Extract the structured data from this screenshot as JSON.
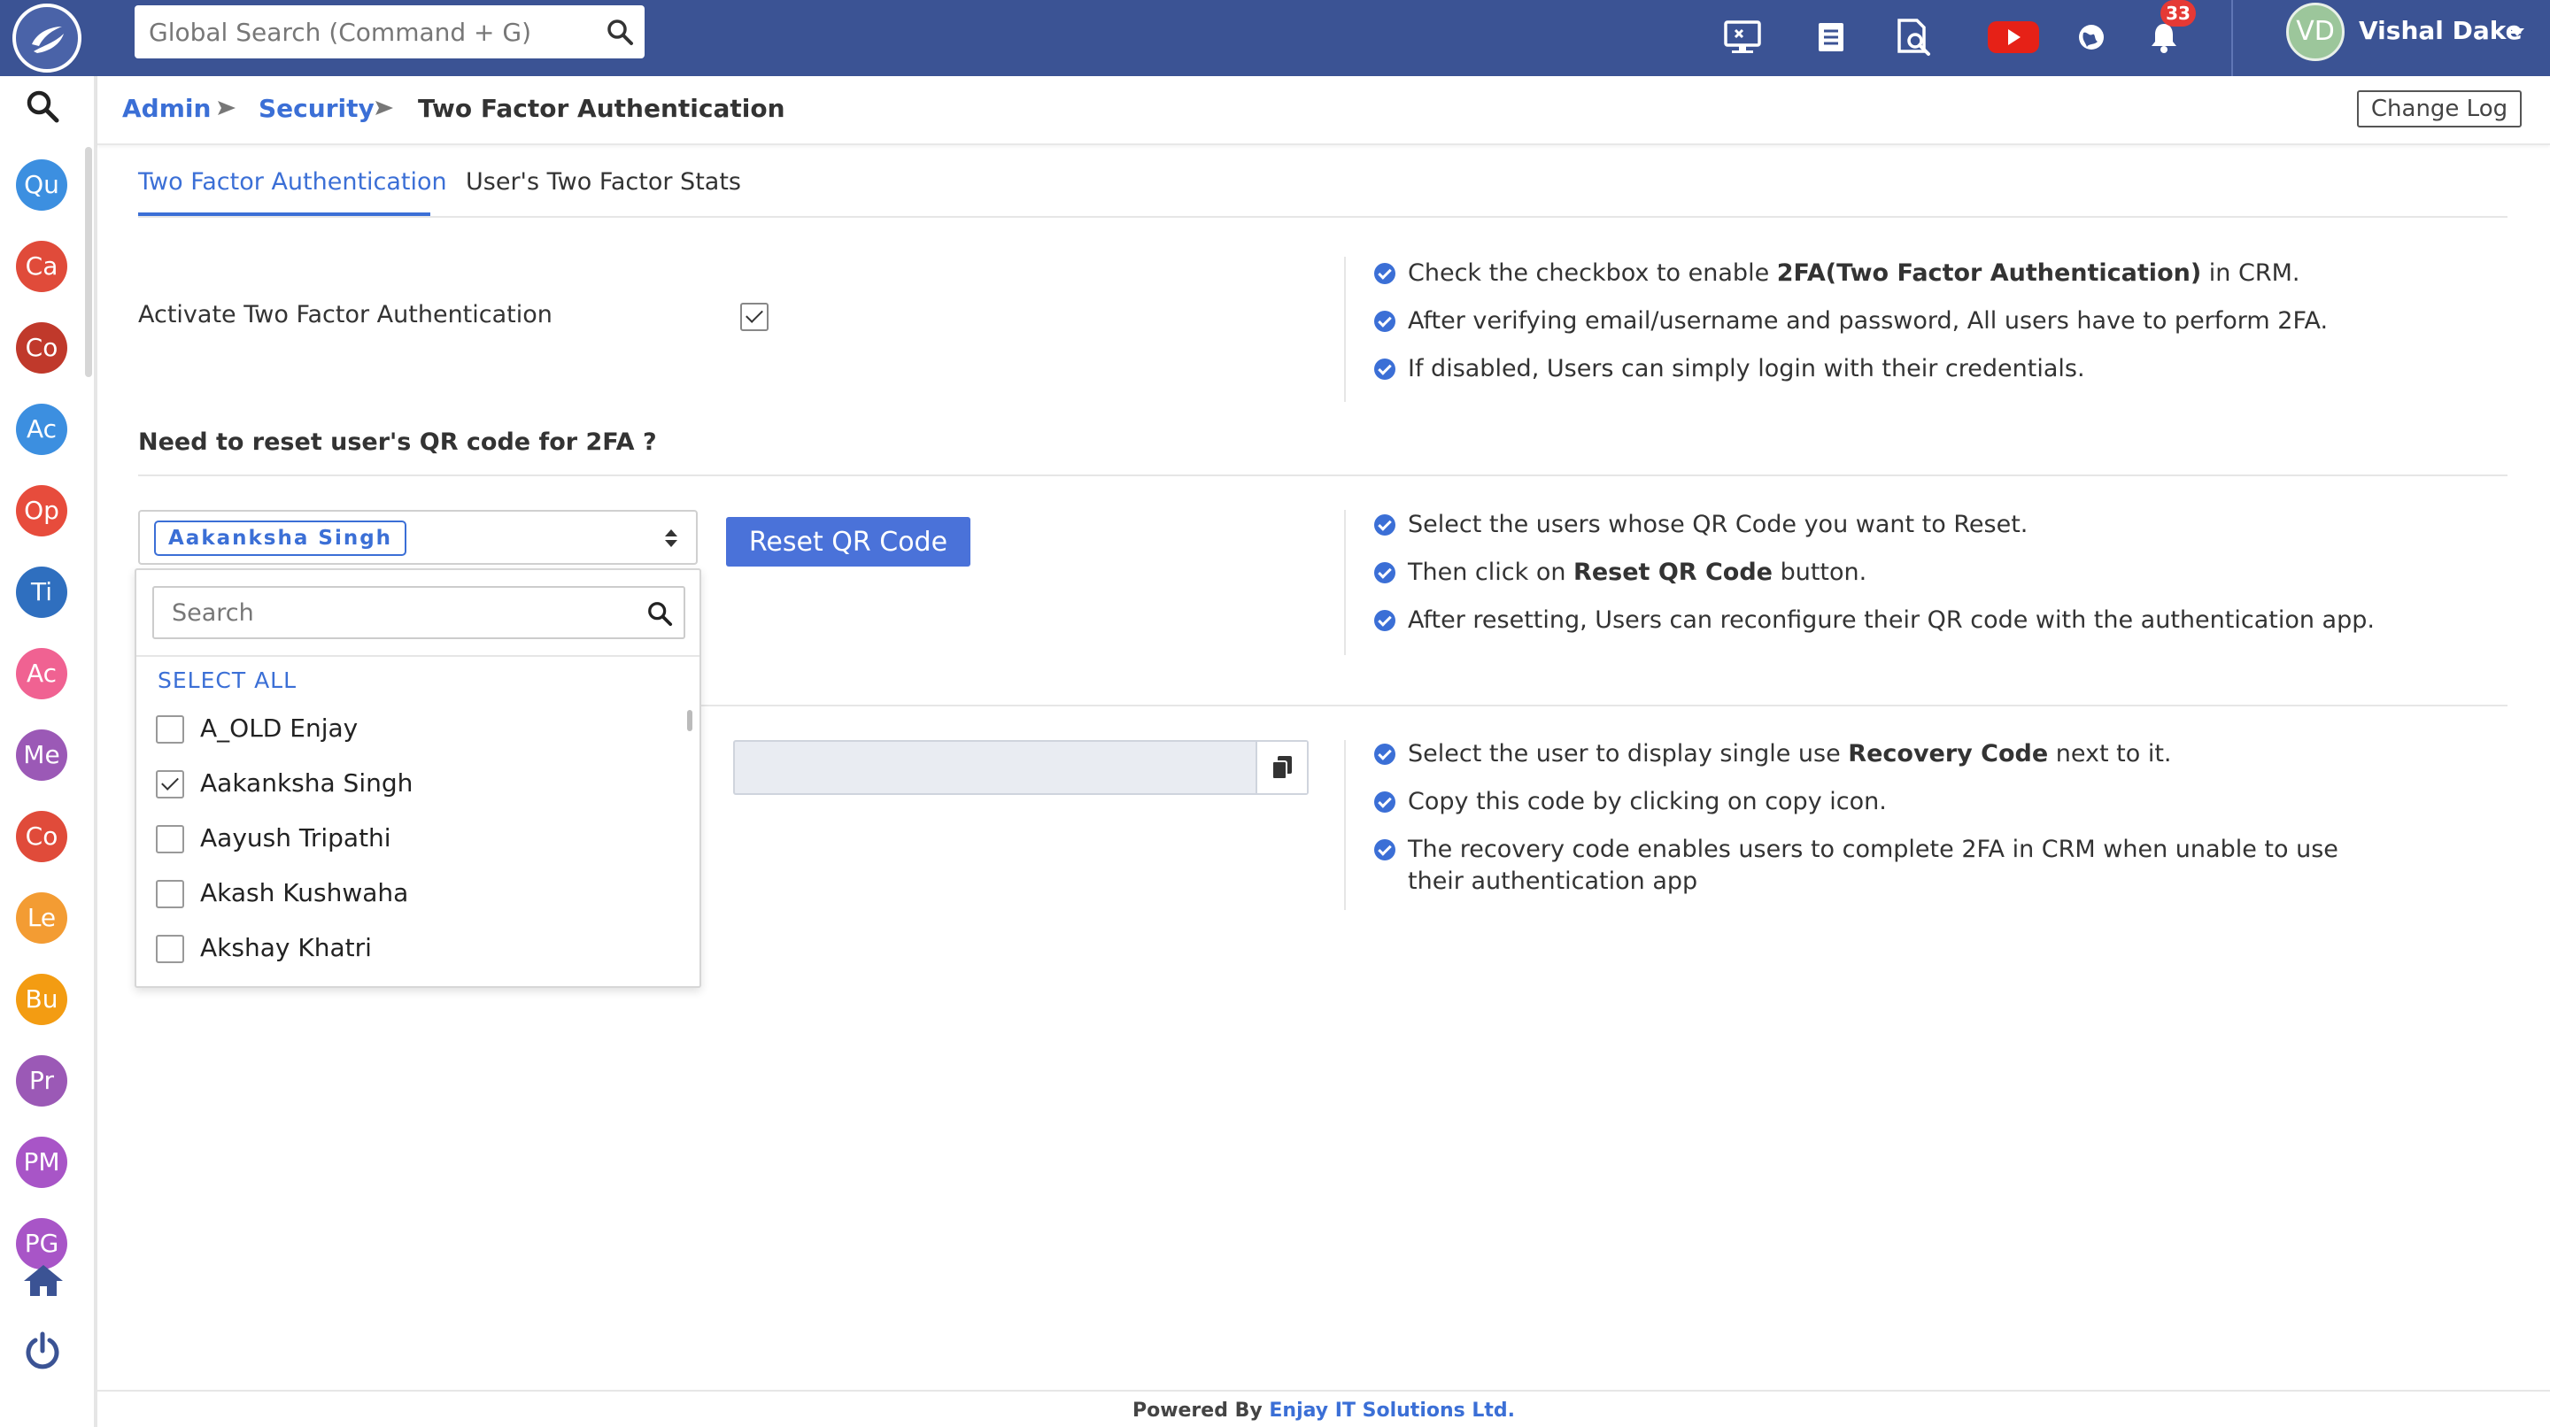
{
  "topbar": {
    "search_placeholder": "Global Search (Command + G)",
    "notification_count": "33",
    "user": {
      "initials": "VD",
      "name": "Vishal Dake"
    },
    "icons": [
      "monitor-icon",
      "list-icon",
      "document-search-icon",
      "youtube-icon",
      "globe-icon",
      "bell-icon"
    ],
    "accent": "#3b5394"
  },
  "sidebar": {
    "modules": [
      {
        "label": "Qu",
        "color": "#3c8fe0"
      },
      {
        "label": "Ca",
        "color": "#e04b3a"
      },
      {
        "label": "Co",
        "color": "#c0392b"
      },
      {
        "label": "Ac",
        "color": "#3c8fe0"
      },
      {
        "label": "Op",
        "color": "#e74c3c"
      },
      {
        "label": "Ti",
        "color": "#2f6fbf"
      },
      {
        "label": "Ac",
        "color": "#f06292"
      },
      {
        "label": "Me",
        "color": "#9b59b6"
      },
      {
        "label": "Co",
        "color": "#e04b3a"
      },
      {
        "label": "Le",
        "color": "#f39c33"
      },
      {
        "label": "Bu",
        "color": "#f39c12"
      },
      {
        "label": "Pr",
        "color": "#9b59b6"
      },
      {
        "label": "PM",
        "color": "#a855c7"
      },
      {
        "label": "PG",
        "color": "#a855c7"
      }
    ]
  },
  "breadcrumb": {
    "items": [
      "Admin",
      "Security",
      "Two Factor Authentication"
    ],
    "change_log": "Change Log"
  },
  "tabs": [
    {
      "label": "Two Factor Authentication",
      "active": true
    },
    {
      "label": "User's Two Factor Stats",
      "active": false
    }
  ],
  "activate": {
    "label": "Activate Two Factor Authentication",
    "checked": true,
    "info": [
      {
        "pre": "Check the checkbox to enable ",
        "bold": "2FA(Two Factor Authentication)",
        "post": " in CRM."
      },
      {
        "pre": "After verifying email/username and password, All users have to perform 2FA.",
        "bold": "",
        "post": ""
      },
      {
        "pre": "If disabled, Users can simply login with their credentials.",
        "bold": "",
        "post": ""
      }
    ]
  },
  "reset": {
    "heading": "Need to reset user's QR code for 2FA ?",
    "selected_chip": "Aakanksha Singh",
    "button_label": "Reset QR Code",
    "info": [
      {
        "pre": "Select the users whose QR Code you want to Reset.",
        "bold": "",
        "post": ""
      },
      {
        "pre": "Then click on ",
        "bold": "Reset QR Code",
        "post": " button."
      },
      {
        "pre": "After resetting, Users can reconfigure their QR code with the authentication app.",
        "bold": "",
        "post": ""
      }
    ]
  },
  "dropdown": {
    "search_placeholder": "Search",
    "select_all": "SELECT ALL",
    "items": [
      {
        "name": "A_OLD Enjay",
        "checked": false
      },
      {
        "name": "Aakanksha Singh",
        "checked": true
      },
      {
        "name": "Aayush Tripathi",
        "checked": false
      },
      {
        "name": "Akash Kushwaha",
        "checked": false
      },
      {
        "name": "Akshay Khatri",
        "checked": false
      }
    ]
  },
  "recovery": {
    "code_value": "",
    "info": [
      {
        "pre": "Select the user to display single use ",
        "bold": "Recovery Code",
        "post": " next to it."
      },
      {
        "pre": "Copy this code by clicking on copy icon.",
        "bold": "",
        "post": ""
      },
      {
        "pre": "The recovery code enables users to complete 2FA in CRM when unable to use their authentication app",
        "bold": "",
        "post": ""
      }
    ]
  },
  "footer": {
    "prefix": "Powered By ",
    "company": "Enjay IT Solutions Ltd."
  }
}
